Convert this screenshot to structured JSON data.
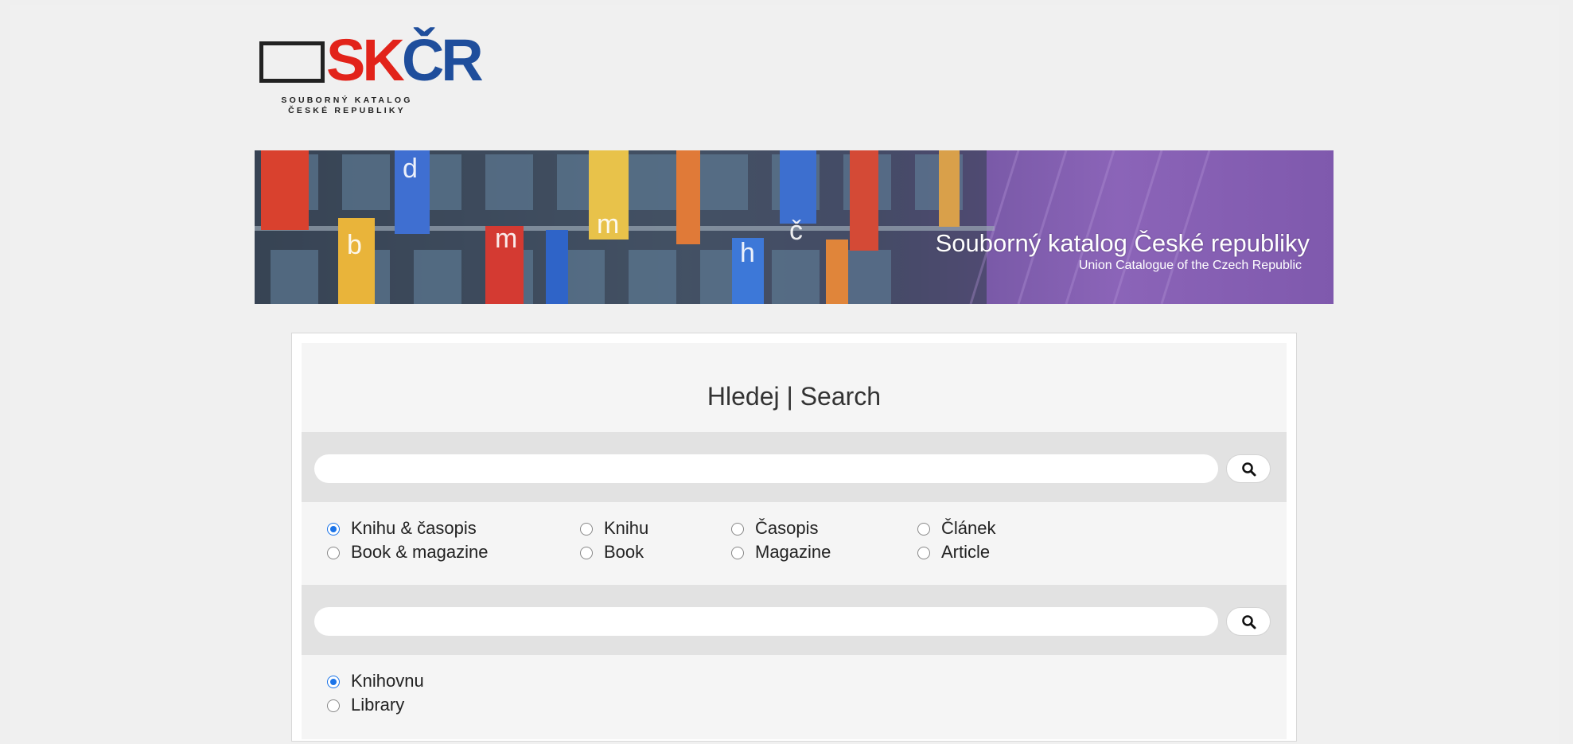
{
  "logo": {
    "letters_red": "SK",
    "letters_blue": "ČR",
    "line1": "SOUBORNÝ KATALOG",
    "line2": "ČESKÉ REPUBLIKY"
  },
  "banner": {
    "title": "Souborný katalog České republiky",
    "subtitle": "Union Catalogue of the Czech Republic"
  },
  "search": {
    "heading": "Hledej | Search",
    "query1": {
      "value": "",
      "placeholder": ""
    },
    "query2": {
      "value": "",
      "placeholder": ""
    },
    "types_cz": [
      {
        "label": "Knihu & časopis",
        "checked": true
      },
      {
        "label": "Knihu",
        "checked": false
      },
      {
        "label": "Časopis",
        "checked": false
      },
      {
        "label": "Článek",
        "checked": false
      }
    ],
    "types_en": [
      {
        "label": "Book & magazine"
      },
      {
        "label": "Book"
      },
      {
        "label": "Magazine"
      },
      {
        "label": "Article"
      }
    ],
    "library_options": [
      {
        "label": "Knihovnu",
        "checked": true
      },
      {
        "label": "Library",
        "checked": false
      }
    ]
  },
  "colors": {
    "accent": "#1a73e8",
    "logo_red": "#e2231a",
    "logo_blue": "#1f4e9c",
    "banner_purple": "#8b64b8"
  },
  "icons": {
    "search_button": "magnifier-icon"
  }
}
